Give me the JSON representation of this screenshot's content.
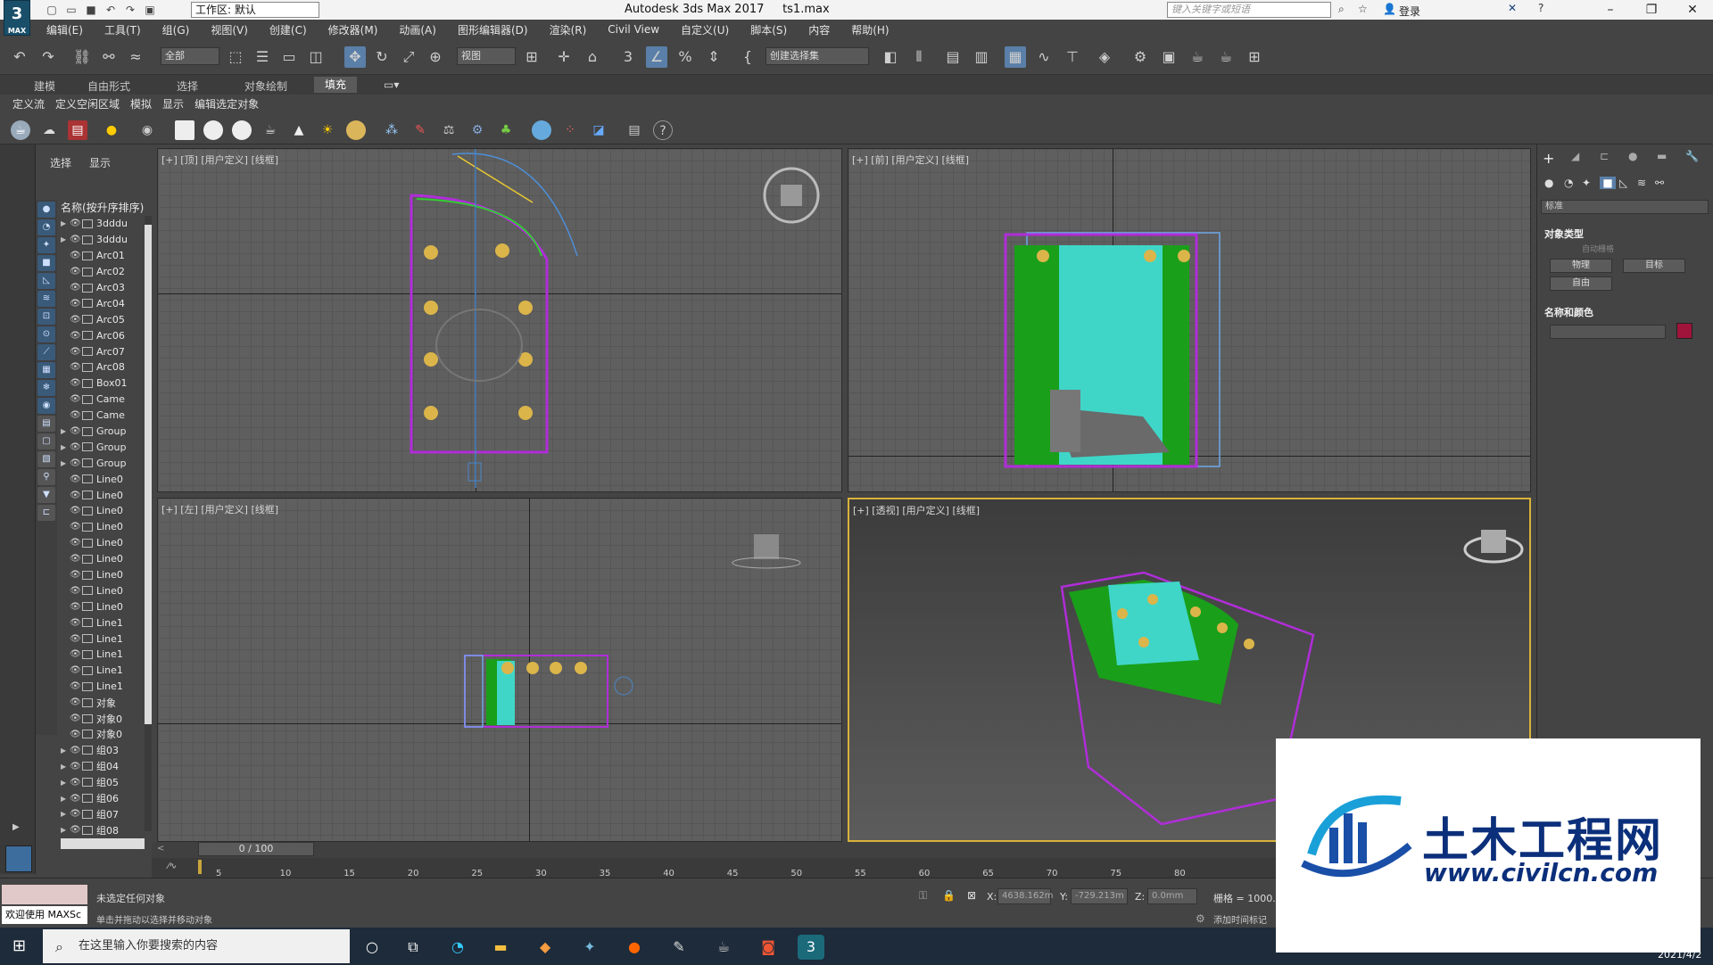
{
  "titlebar": {
    "logo": "3",
    "logo_sub": "MAX",
    "workspace": "工作区: 默认",
    "app_title": "Autodesk 3ds Max 2017",
    "file_name": "ts1.max",
    "search_placeholder": "键入关键字或短语",
    "login": "登录"
  },
  "menu": [
    "编辑(E)",
    "工具(T)",
    "组(G)",
    "视图(V)",
    "创建(C)",
    "修改器(M)",
    "动画(A)",
    "图形编辑器(D)",
    "渲染(R)",
    "Civil View",
    "自定义(U)",
    "脚本(S)",
    "内容",
    "帮助(H)"
  ],
  "toolbar": {
    "selection_filter": "全部",
    "ref_coord": "视图",
    "named_selection": "创建选择集"
  },
  "ribbon": {
    "tabs": [
      "建模",
      "自由形式",
      "选择",
      "对象绘制",
      "填充"
    ],
    "active_tab": "填充",
    "sub_items": [
      "定义流",
      "定义空闲区域",
      "模拟",
      "显示",
      "编辑选定对象"
    ]
  },
  "explorer": {
    "tabs": [
      "选择",
      "显示"
    ],
    "header": "名称(按升序排序)",
    "items": [
      {
        "name": "3dddu",
        "expand": true
      },
      {
        "name": "3dddu",
        "expand": true
      },
      {
        "name": "Arc01",
        "expand": false
      },
      {
        "name": "Arc02",
        "expand": false
      },
      {
        "name": "Arc03",
        "expand": false
      },
      {
        "name": "Arc04",
        "expand": false
      },
      {
        "name": "Arc05",
        "expand": false
      },
      {
        "name": "Arc06",
        "expand": false
      },
      {
        "name": "Arc07",
        "expand": false
      },
      {
        "name": "Arc08",
        "expand": false
      },
      {
        "name": "Box01",
        "expand": false
      },
      {
        "name": "Came",
        "expand": false
      },
      {
        "name": "Came",
        "expand": false
      },
      {
        "name": "Group",
        "expand": true
      },
      {
        "name": "Group",
        "expand": true
      },
      {
        "name": "Group",
        "expand": true
      },
      {
        "name": "Line0",
        "expand": false
      },
      {
        "name": "Line0",
        "expand": false
      },
      {
        "name": "Line0",
        "expand": false
      },
      {
        "name": "Line0",
        "expand": false
      },
      {
        "name": "Line0",
        "expand": false
      },
      {
        "name": "Line0",
        "expand": false
      },
      {
        "name": "Line0",
        "expand": false
      },
      {
        "name": "Line0",
        "expand": false
      },
      {
        "name": "Line0",
        "expand": false
      },
      {
        "name": "Line1",
        "expand": false
      },
      {
        "name": "Line1",
        "expand": false
      },
      {
        "name": "Line1",
        "expand": false
      },
      {
        "name": "Line1",
        "expand": false
      },
      {
        "name": "Line1",
        "expand": false
      },
      {
        "name": "对象",
        "expand": false
      },
      {
        "name": "对象0",
        "expand": false
      },
      {
        "name": "对象0",
        "expand": false
      },
      {
        "name": "组03",
        "expand": true
      },
      {
        "name": "组04",
        "expand": true
      },
      {
        "name": "组05",
        "expand": true
      },
      {
        "name": "组06",
        "expand": true
      },
      {
        "name": "组07",
        "expand": true
      },
      {
        "name": "组08",
        "expand": true
      }
    ]
  },
  "viewports": {
    "top": "[+] [顶] [用户定义] [线框]",
    "front": "[+] [前] [用户定义] [线框]",
    "left": "[+] [左] [用户定义] [线框]",
    "persp": "[+] [透视] [用户定义] [线框]"
  },
  "command_panel": {
    "category": "标准",
    "object_type": "对象类型",
    "auto_grid": "自动栅格",
    "buttons": [
      "物理",
      "目标",
      "自由"
    ],
    "name_color": "名称和颜色",
    "swatch_color": "#a0143c"
  },
  "timeline": {
    "slider": "0 / 100",
    "ticks": [
      "5",
      "10",
      "15",
      "20",
      "25",
      "30",
      "35",
      "40",
      "45",
      "50",
      "55",
      "60",
      "65",
      "70",
      "75",
      "80"
    ]
  },
  "status": {
    "maxscript_label": "欢迎使用 MAXSc",
    "line1": "未选定任何对象",
    "line2": "单击并拖动以选择并移动对象",
    "x_label": "X:",
    "x_value": "4638.162m",
    "y_label": "Y:",
    "y_value": "-729.213m",
    "z_label": "Z:",
    "z_value": "0.0mm",
    "grid": "栅格 = 1000.0",
    "add_time_tag": "添加时间标记"
  },
  "taskbar": {
    "search_placeholder": "在这里输入你要搜索的内容",
    "date": "2021/4/2"
  },
  "watermark": {
    "title": "土木工程网",
    "url": "www.civilcn.com"
  }
}
